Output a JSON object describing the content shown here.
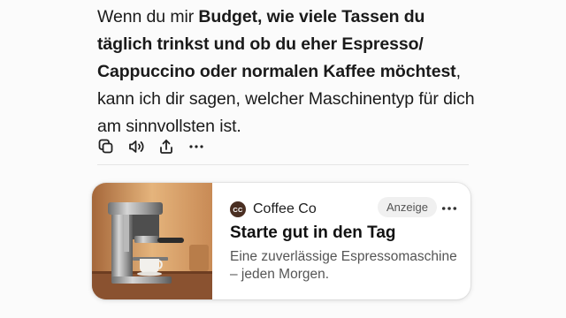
{
  "message": {
    "part1": "Wenn du mir ",
    "bold1": "Budget, wie viele Tassen du täglich trinkst und ob du eher Espresso/ Cappuccino oder normalen Kaffee möchtest",
    "part2": ", kann ich dir sagen, welcher Maschinentyp für dich am sinnvollsten ist."
  },
  "actions": [
    {
      "icon": "copy-icon"
    },
    {
      "icon": "speaker-icon"
    },
    {
      "icon": "share-icon"
    },
    {
      "icon": "more-horizontal-icon"
    }
  ],
  "ad": {
    "logo_text": "CC",
    "brand": "Coffee Co",
    "badge": "Anzeige",
    "title": "Starte gut in den Tag",
    "description": "Eine zuverlässige Espressomaschine – jeden Morgen.",
    "image": "espresso-machine-photo",
    "colors": {
      "logo_bg": "#4a2f22",
      "badge_bg": "#f0f0f0"
    }
  }
}
